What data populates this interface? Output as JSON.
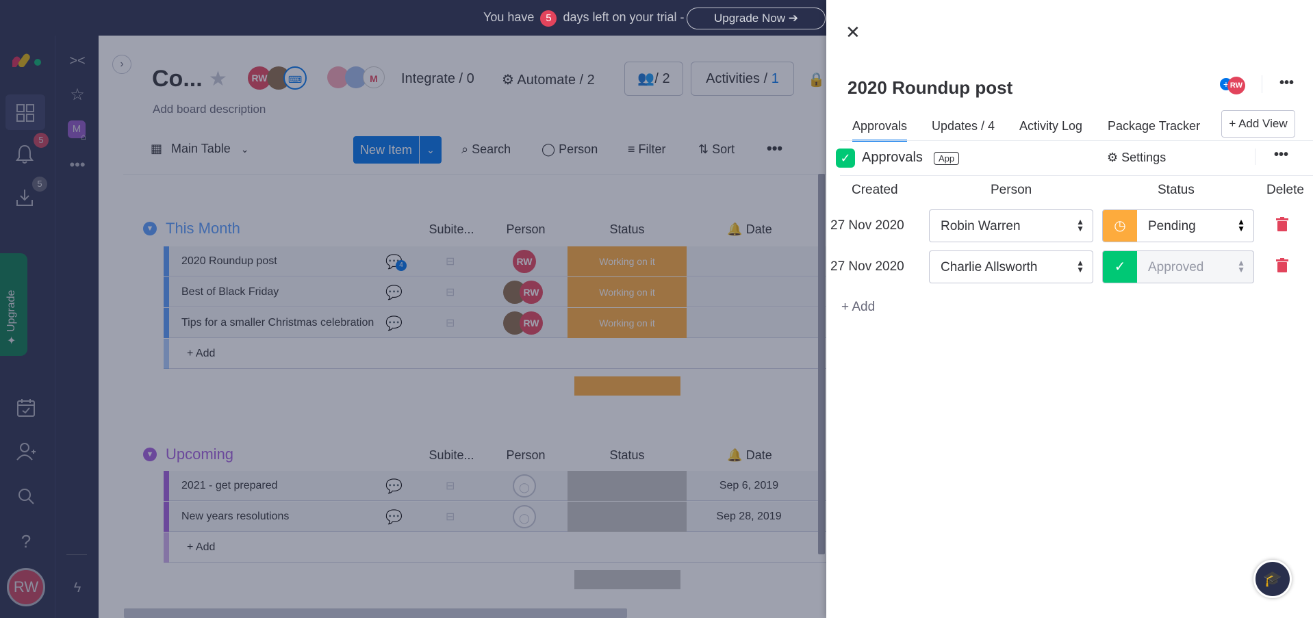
{
  "topbar": {
    "trial_prefix": "You have",
    "trial_days": "5",
    "trial_suffix": "days left on your trial -",
    "upgrade_label": "Upgrade Now"
  },
  "leftnav": {
    "notifications_count": "5",
    "inbox_count": "5",
    "upgrade_label": "Upgrade",
    "user_initials": "RW",
    "workspace_initial": "M"
  },
  "board": {
    "title": "Co...",
    "description": "Add board description",
    "integrate": "Integrate / 0",
    "automate": "Automate / 2",
    "members": "/ 2",
    "activities_label": "Activities /",
    "activities_count": "1",
    "view": "Main Table",
    "new_item": "New Item",
    "search": "Search",
    "person": "Person",
    "filter": "Filter",
    "sort": "Sort",
    "columns": {
      "subitems": "Subite...",
      "person": "Person",
      "status": "Status",
      "date": "Date"
    },
    "add_label": "+ Add",
    "groups": [
      {
        "title": "This Month",
        "color": "#579bfc",
        "rows": [
          {
            "name": "2020 Roundup post",
            "status": "Working on it",
            "date": ""
          },
          {
            "name": "Best of Black Friday",
            "status": "Working on it",
            "date": ""
          },
          {
            "name": "Tips for a smaller Christmas celebration",
            "status": "Working on it",
            "date": ""
          }
        ]
      },
      {
        "title": "Upcoming",
        "color": "#a25ddc",
        "rows": [
          {
            "name": "2021 - get prepared",
            "status": "",
            "date": "Sep 6, 2019"
          },
          {
            "name": "New years resolutions",
            "status": "",
            "date": "Sep 28, 2019"
          }
        ]
      }
    ],
    "updates_badge": "4",
    "avatar_initials": "RW"
  },
  "panel": {
    "title": "2020 Roundup post",
    "avatar_initials": "RW",
    "tabs": [
      "Approvals",
      "Updates / 4",
      "Activity Log",
      "Package Tracker"
    ],
    "add_view": "+ Add View",
    "app_name": "Approvals",
    "app_badge": "App",
    "settings": "Settings",
    "headers": {
      "created": "Created",
      "person": "Person",
      "status": "Status",
      "delete": "Delete"
    },
    "rows": [
      {
        "created": "27 Nov 2020",
        "person": "Robin Warren",
        "status": "Pending",
        "status_color": "#fdab3d"
      },
      {
        "created": "27 Nov 2020",
        "person": "Charlie Allsworth",
        "status": "Approved",
        "status_color": "#00c875"
      }
    ],
    "add_label": "+ Add"
  },
  "colors": {
    "working_on_it": "#fdab3d",
    "accent": "#0073ea",
    "delete": "#e2445c"
  }
}
